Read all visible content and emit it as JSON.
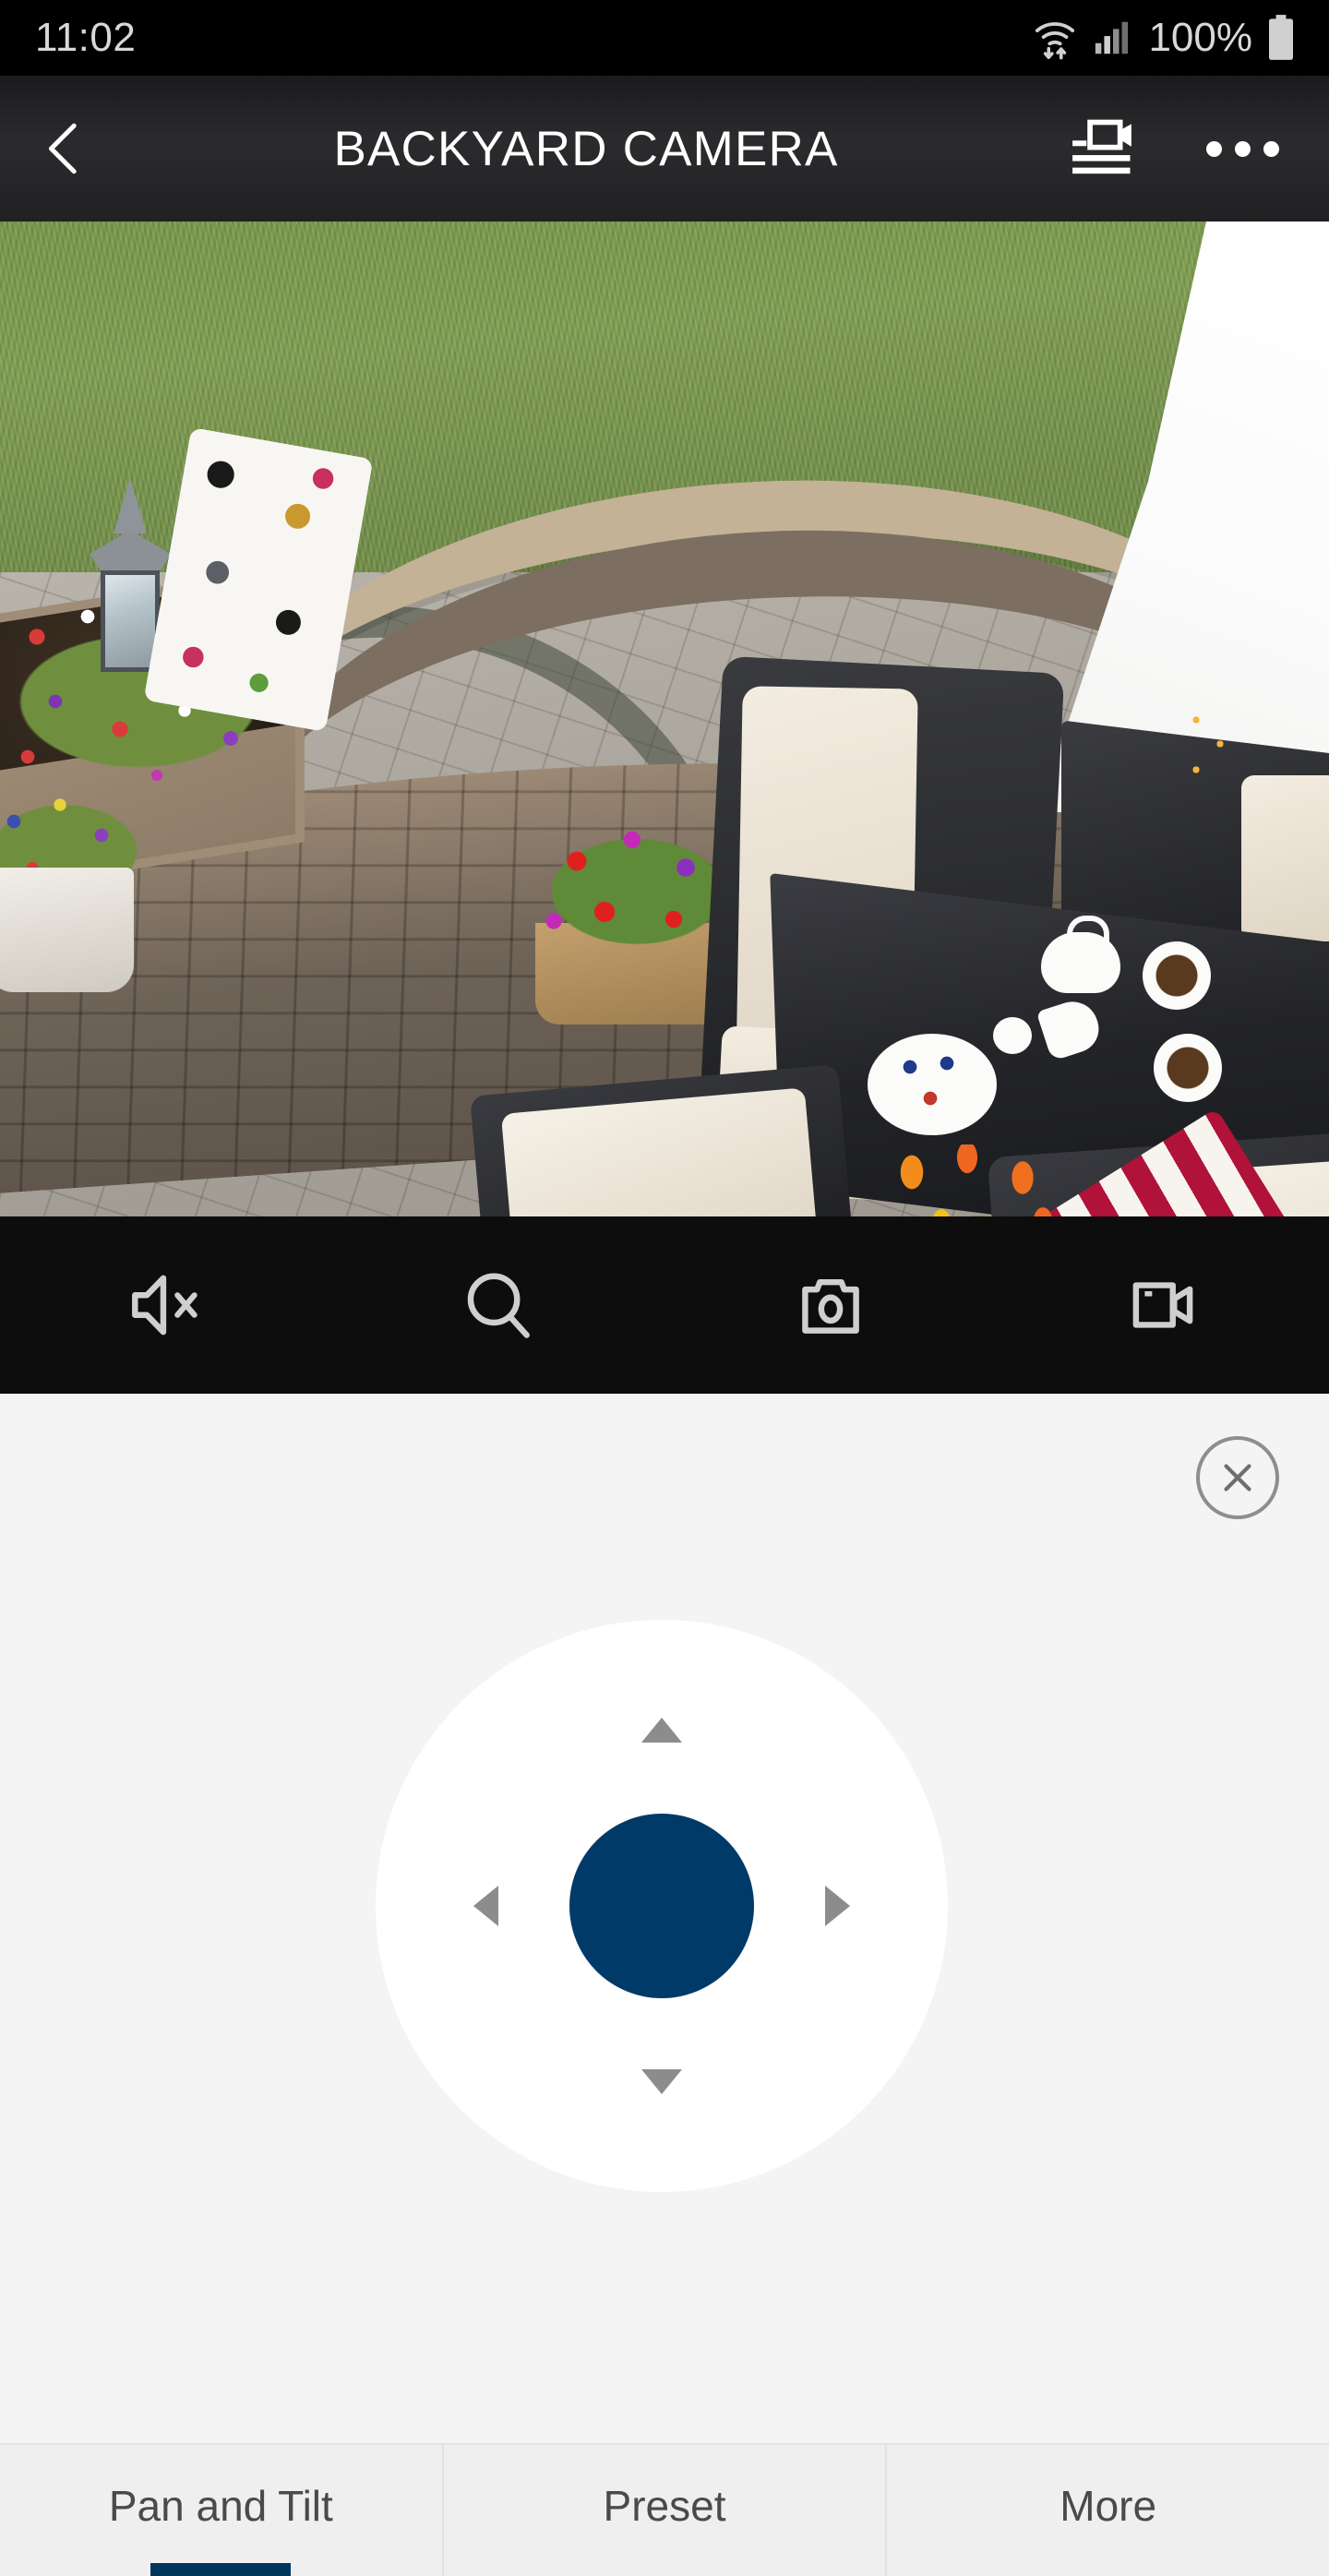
{
  "status_bar": {
    "time": "11:02",
    "battery_percent": "100%",
    "icons": [
      "wifi-data-icon",
      "cellular-signal-icon",
      "battery-icon"
    ]
  },
  "header": {
    "back_icon": "back-chevron-icon",
    "title": "BACKYARD CAMERA",
    "video_list_icon": "video-list-icon",
    "overflow_icon": "overflow-menu-icon"
  },
  "video": {
    "scene_description": "Backyard patio live view",
    "alt": "Backyard patio with stone wall, wicker furniture and flowers"
  },
  "video_controls": [
    {
      "name": "mute-button",
      "icon": "speaker-mute-icon",
      "label": "Mute"
    },
    {
      "name": "zoom-button",
      "icon": "magnifier-icon",
      "label": "Zoom"
    },
    {
      "name": "snapshot-button",
      "icon": "camera-icon",
      "label": "Snapshot"
    },
    {
      "name": "record-button",
      "icon": "video-camera-icon",
      "label": "Record"
    }
  ],
  "ptz": {
    "close_icon": "close-circle-icon",
    "joystick_name": "pan-tilt-joystick",
    "center_color": "#003a68",
    "arrow_color": "#8c8c8c",
    "directions": [
      "up",
      "down",
      "left",
      "right"
    ]
  },
  "tabs": [
    {
      "label": "Pan and Tilt",
      "active": true
    },
    {
      "label": "Preset",
      "active": false
    },
    {
      "label": "More",
      "active": false
    }
  ],
  "colors": {
    "accent": "#003a68",
    "tab_indicator": "#00355e",
    "panel_bg": "#f4f4f4",
    "tabbar_bg": "#efefef",
    "header_bg": "#242427",
    "control_bar_bg": "#0d0d0d"
  }
}
